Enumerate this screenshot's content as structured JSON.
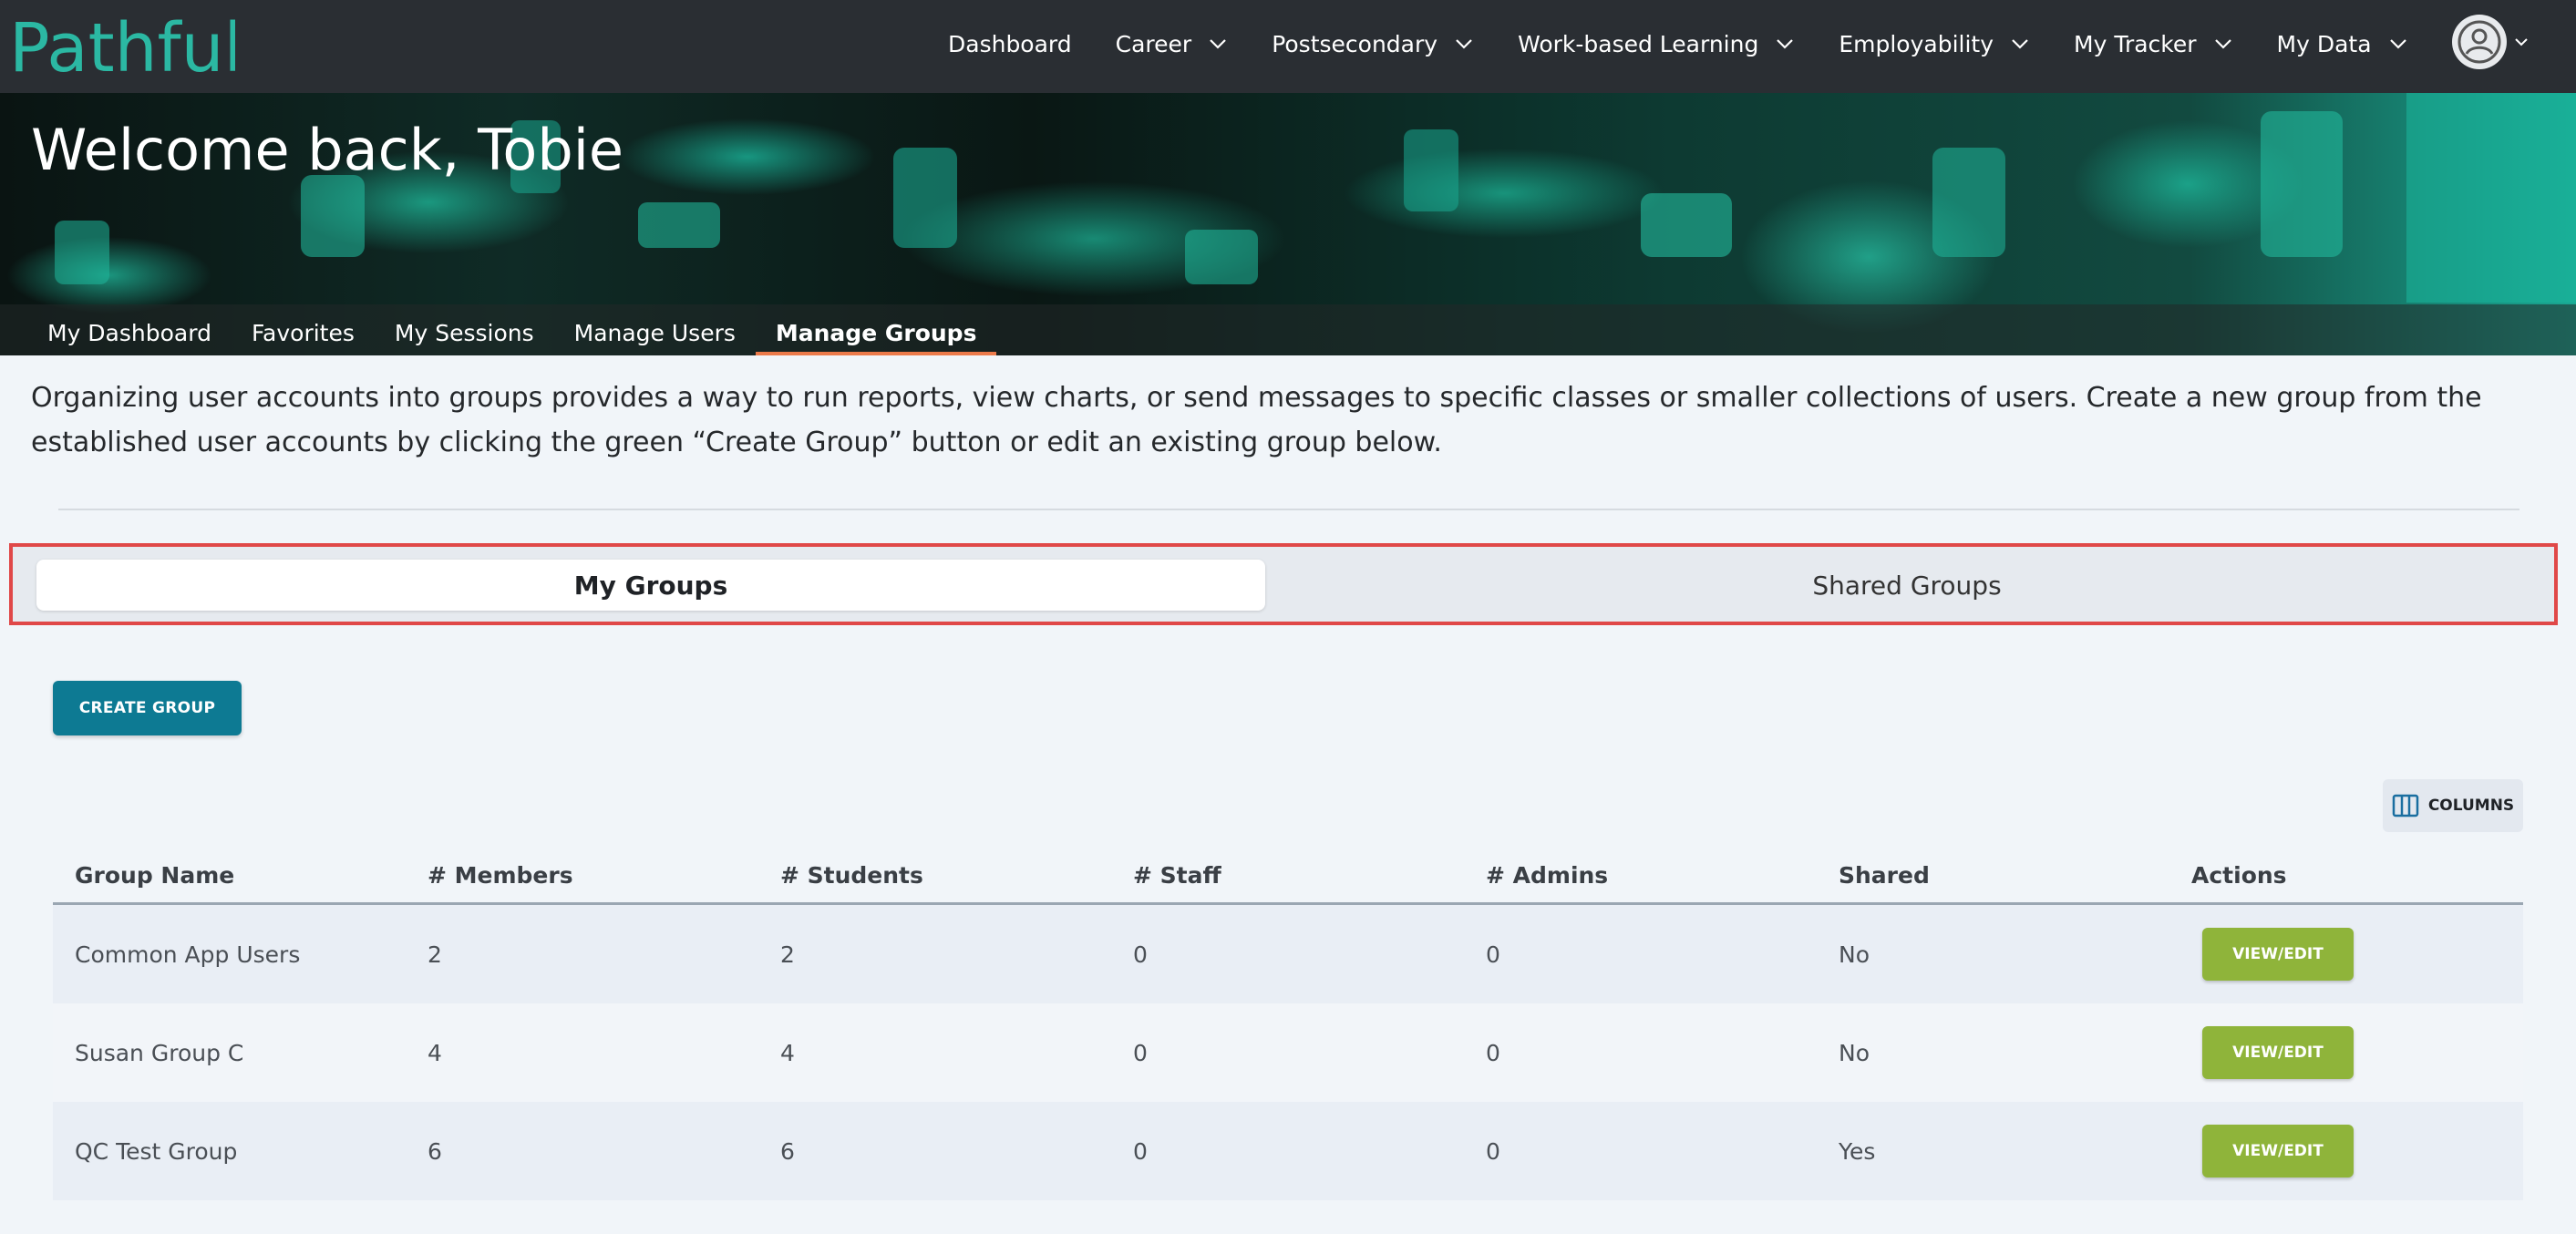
{
  "brand": {
    "logo_text": "Pathful",
    "logo_color": "#2bb8a3"
  },
  "topnav": {
    "items": [
      {
        "label": "Dashboard",
        "dropdown": false
      },
      {
        "label": "Career",
        "dropdown": true
      },
      {
        "label": "Postsecondary",
        "dropdown": true
      },
      {
        "label": "Work-based Learning",
        "dropdown": true
      },
      {
        "label": "Employability",
        "dropdown": true
      },
      {
        "label": "My Tracker",
        "dropdown": true
      },
      {
        "label": "My Data",
        "dropdown": true
      }
    ]
  },
  "hero": {
    "title": "Welcome back, Tobie"
  },
  "subnav": {
    "items": [
      {
        "label": "My Dashboard",
        "active": false
      },
      {
        "label": "Favorites",
        "active": false
      },
      {
        "label": "My Sessions",
        "active": false
      },
      {
        "label": "Manage Users",
        "active": false
      },
      {
        "label": "Manage Groups",
        "active": true
      }
    ]
  },
  "description": "Organizing user accounts into groups provides a way to run reports, view charts, or send messages to specific classes or smaller collections of users. Create a new group from the established user accounts by clicking the green “Create Group” button or edit an existing group below.",
  "tabs": {
    "my_groups": "My Groups",
    "shared_groups": "Shared Groups",
    "active": "my_groups"
  },
  "actions": {
    "create_group": "CREATE GROUP",
    "columns": "COLUMNS"
  },
  "table": {
    "headers": [
      "Group Name",
      "# Members",
      "# Students",
      "# Staff",
      "# Admins",
      "Shared",
      "Actions"
    ],
    "rows": [
      {
        "name": "Common App Users",
        "members": "2",
        "students": "2",
        "staff": "0",
        "admins": "0",
        "shared": "No",
        "action": "VIEW/EDIT"
      },
      {
        "name": "Susan Group C",
        "members": "4",
        "students": "4",
        "staff": "0",
        "admins": "0",
        "shared": "No",
        "action": "VIEW/EDIT"
      },
      {
        "name": "QC Test Group",
        "members": "6",
        "students": "6",
        "staff": "0",
        "admins": "0",
        "shared": "Yes",
        "action": "VIEW/EDIT"
      }
    ]
  },
  "colors": {
    "nav_bg": "#2a2e33",
    "create_button": "#0d7a93",
    "view_button": "#8fb43a",
    "active_underline": "#ec7a4a",
    "highlight_frame": "#e04848"
  }
}
